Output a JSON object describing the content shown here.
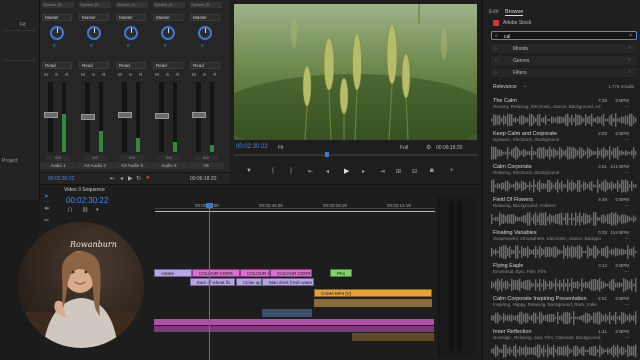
{
  "left_strip": {
    "labels": [
      "Fit",
      "Project"
    ]
  },
  "mixer": {
    "channels": [
      {
        "header": "System (S...",
        "select": "Master",
        "knob": "0",
        "read": "Read",
        "fader_value": "0.0",
        "name": "Audio 1",
        "level": 0.55
      },
      {
        "header": "System (S...",
        "select": "Master",
        "knob": "0",
        "read": "Read",
        "fader_value": "0.0",
        "name": "A2  Audio 2",
        "level": 0.3
      },
      {
        "header": "System (S...",
        "select": "Master",
        "knob": "0",
        "read": "Read",
        "fader_value": "0.0",
        "name": "A3  Audio 3",
        "level": 0.2
      },
      {
        "header": "System (S...",
        "select": "Master",
        "knob": "0",
        "read": "Read",
        "fader_value": "0.0",
        "name": "Audio 4",
        "level": 0.15
      },
      {
        "header": "System (S...",
        "select": "Master",
        "knob": "0",
        "read": "Read",
        "fader_value": "0.0",
        "name": "A5",
        "level": 0.1
      }
    ],
    "msr": "M S R",
    "time_left": "00:02:30:22",
    "time_right": "00:06:18:20"
  },
  "monitor": {
    "timecode": "00:02:30:22",
    "fit": "Fit",
    "quality": "Full",
    "duration": "00:06:18:20"
  },
  "timeline": {
    "sequence_name": "Video 3 Sequence",
    "timecode": "00:02:30:22",
    "ruler": [
      "00:02:30:00",
      "00:02:44:20",
      "00:03:03:19",
      "00:03:14:19"
    ],
    "clips_v": [
      {
        "label": "Adobe",
        "color": "#b5a7e6"
      },
      {
        "label": "COLOUR CORR",
        "color": "#e06bd2"
      },
      {
        "label": "COLOUR C",
        "color": "#e06bd2"
      },
      {
        "label": "COLOUR CORRECTION",
        "color": "#e06bd2"
      },
      {
        "label": "Pho",
        "color": "#7ed36a"
      },
      {
        "label": "Ears of wheat flo",
        "color": "#b5a7e6"
      },
      {
        "label": "Close up o",
        "color": "#b5a7e6"
      },
      {
        "label": "Man drink fresh water f",
        "color": "#b5a7e6"
      },
      {
        "label": "CAMA MP4 [V]",
        "color": "#e8a23c"
      }
    ]
  },
  "browse": {
    "tabs": [
      "Edit",
      "Browse"
    ],
    "source": "Adobe Stock",
    "search_value": "cal",
    "filters": [
      "Moods",
      "Genres",
      "Filters"
    ],
    "sort": "Relevance",
    "result_count": "1,775 results",
    "tracks": [
      {
        "title": "The Calm",
        "genres": "Dreamy, Relaxing, Electronic, Dance, Background, Amb...",
        "duration": "7:28",
        "bpm": "0 BPM"
      },
      {
        "title": "Keep Calm and Corporate",
        "genres": "Dynamic, Electronic, Background",
        "duration": "2:03",
        "bpm": "0 BPM"
      },
      {
        "title": "Calm Corporate",
        "genres": "Relaxing, Electronic, Background",
        "duration": "4:51",
        "bpm": "141 BPM"
      },
      {
        "title": "Field Of Flowers",
        "genres": "Relaxing, Background, Ambient",
        "duration": "4:49",
        "bpm": "0 BPM"
      },
      {
        "title": "Floating Variables",
        "genres": "Suspenseful, Atmosphere, Electronic, Dance, Backgro...",
        "duration": "0:33",
        "bpm": "124 BPM"
      },
      {
        "title": "Flying Eagle",
        "genres": "Emotional, Epic, Film, Film",
        "duration": "3:12",
        "bpm": "0 BPM"
      },
      {
        "title": "Calm Corporate Inspiring Presentation",
        "genres": "Inspiring, Happy, Relaxing, Background, Rock, Indie",
        "duration": "2:51",
        "bpm": "0 BPM"
      },
      {
        "title": "Inner Reflection",
        "genres": "Nostalgic, Relaxing, Sad, Film, Classical, Background, P...",
        "duration": "1:41",
        "bpm": "0 BPM"
      }
    ]
  },
  "webcam": {
    "overlay_text": "Rowanburn"
  },
  "colors": {
    "accent_blue": "#4a8be8",
    "playhead": "#3f79d6"
  }
}
